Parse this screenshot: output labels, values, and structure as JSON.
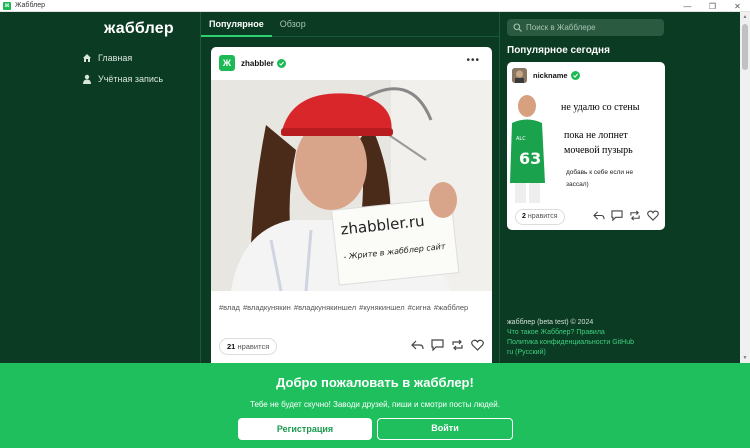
{
  "window": {
    "title": "Жабблер",
    "app_icon": "zh-logo-icon",
    "controls": [
      "—",
      "❐",
      "✕"
    ]
  },
  "sidebar": {
    "logo": "жабблер",
    "items": [
      {
        "label": "Главная",
        "icon": "home-icon"
      },
      {
        "label": "Учётная запись",
        "icon": "user-icon"
      }
    ]
  },
  "tabs": [
    {
      "label": "Популярное",
      "active": true
    },
    {
      "label": "Обзор",
      "active": false
    }
  ],
  "post": {
    "author": "zhabbler",
    "avatar_letter": "Ж",
    "photo_sign": {
      "line1": "zhabbler.ru",
      "line2": "- Жрите в жабблер сайт"
    },
    "tags": "#влад #владкунякин #владкунякиншел #кунякиншел #сигна #жабблер",
    "likes_count": "21",
    "likes_label": "нравится"
  },
  "search": {
    "placeholder": "Поиск в Жабблере"
  },
  "popular_today": {
    "title": "Популярное сегодня",
    "post": {
      "author": "nickname",
      "meme": {
        "line1": "не удалю со стены",
        "line2": "пока не лопнет",
        "line3": "мочевой пузырь",
        "small1": "добавь к себе если не",
        "small2": "зассал)",
        "jersey": "63",
        "jersey_top": "ALC"
      },
      "likes_count": "2",
      "likes_label": "нравится"
    }
  },
  "footer": {
    "copyright": "жабблер (beta test) © 2024",
    "links": [
      "Что такое Жабблер?",
      "Правила",
      "Политика конфиденциальности",
      "GitHub"
    ],
    "language": "ru (Русский)"
  },
  "banner": {
    "title": "Добро пожаловать в жабблер!",
    "subtitle": "Тебе не будет скучно! Заводи друзей, пиши и смотри посты людей.",
    "register_label": "Регистрация",
    "login_label": "Войти"
  },
  "colors": {
    "bg": "#0b3b23",
    "accent": "#1fbf5e",
    "verified": "#1db954"
  }
}
